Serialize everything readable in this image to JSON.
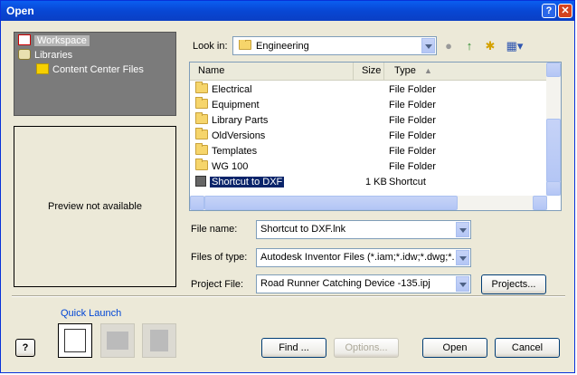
{
  "window": {
    "title": "Open",
    "help_btn": "?",
    "close_btn": "✕"
  },
  "left_panel": {
    "items": [
      {
        "label": "Workspace",
        "icon": "workspace-icon",
        "selected": true
      },
      {
        "label": "Libraries",
        "icon": "libraries-icon"
      },
      {
        "label": "Content Center Files",
        "icon": "folder-icon"
      }
    ]
  },
  "preview": {
    "text": "Preview not available"
  },
  "look_in": {
    "label": "Look in:",
    "value": "Engineering"
  },
  "toolbar": {
    "back": "back-icon",
    "up": "up-folder-icon",
    "new_folder": "new-folder-icon",
    "views": "views-menu-icon"
  },
  "file_list": {
    "columns": [
      "Name",
      "Size",
      "Type"
    ],
    "rows": [
      {
        "name": "Electrical",
        "size": "",
        "type": "File Folder",
        "icon": "folder-icon"
      },
      {
        "name": "Equipment",
        "size": "",
        "type": "File Folder",
        "icon": "folder-icon"
      },
      {
        "name": "Library Parts",
        "size": "",
        "type": "File Folder",
        "icon": "folder-icon"
      },
      {
        "name": "OldVersions",
        "size": "",
        "type": "File Folder",
        "icon": "folder-icon"
      },
      {
        "name": "Templates",
        "size": "",
        "type": "File Folder",
        "icon": "folder-icon"
      },
      {
        "name": "WG 100",
        "size": "",
        "type": "File Folder",
        "icon": "folder-icon"
      },
      {
        "name": "Shortcut to DXF",
        "size": "1 KB",
        "type": "Shortcut",
        "icon": "shortcut-icon",
        "selected": true
      }
    ]
  },
  "file_name": {
    "label": "File name:",
    "value": "Shortcut to DXF.lnk"
  },
  "file_type": {
    "label": "Files of type:",
    "value": "Autodesk Inventor Files (*.iam;*.idw;*.dwg;*.ip"
  },
  "project": {
    "label": "Project File:",
    "value": "Road Runner Catching Device -135.ipj",
    "button": "Projects..."
  },
  "quick_launch": {
    "label": "Quick Launch"
  },
  "buttons": {
    "find": "Find ...",
    "options": "Options...",
    "open": "Open",
    "cancel": "Cancel",
    "help": "?"
  }
}
